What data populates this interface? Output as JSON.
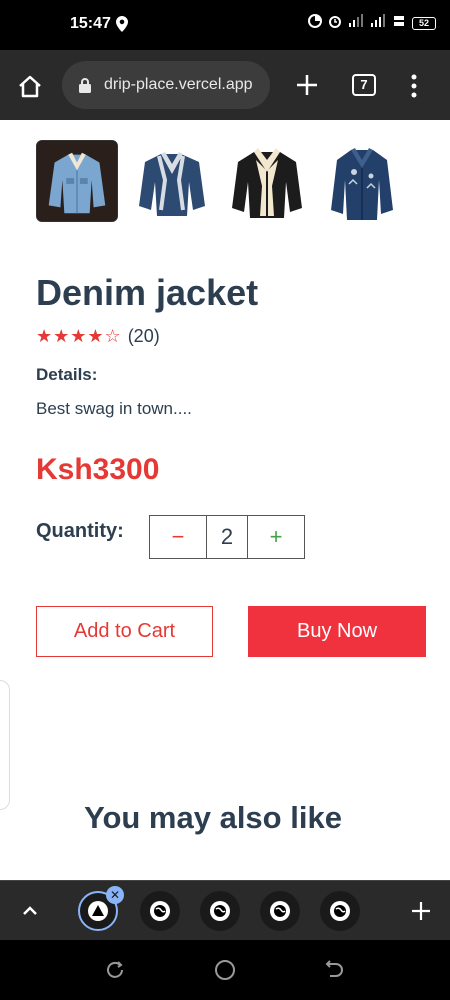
{
  "status_bar": {
    "time": "15:47",
    "battery": "52"
  },
  "browser": {
    "url": "drip-place.vercel.app",
    "tab_count": "7"
  },
  "product": {
    "thumbnails": [
      {
        "name": "light-denim-jacket",
        "colors": {
          "body": "#7aa6cf",
          "collar": "#efe6d6"
        }
      },
      {
        "name": "dark-denim-jacket",
        "colors": {
          "body": "#2d4a72",
          "collar": "#d8dde4"
        }
      },
      {
        "name": "black-sherpa-jacket",
        "colors": {
          "body": "#1c1c1c",
          "collar": "#f3e8cf"
        }
      },
      {
        "name": "embroidered-denim-jacket",
        "colors": {
          "body": "#23406a",
          "collar": "#23406a"
        }
      }
    ],
    "title": "Denim jacket",
    "rating": 4,
    "rating_max": 5,
    "stars_text": "★★★★☆",
    "reviews": "(20)",
    "details_label": "Details:",
    "details_text": "Best swag in town....",
    "price": "Ksh3300",
    "quantity_label": "Quantity:",
    "quantity": "2",
    "minus_symbol": "−",
    "plus_symbol": "+",
    "add_to_cart": "Add to Cart",
    "buy_now": "Buy Now"
  },
  "recommendations": {
    "heading": "You may also like"
  },
  "colors": {
    "accent_red": "#e53935",
    "heading_navy": "#2c3e50",
    "plus_green": "#43a047"
  },
  "tab_strip": {
    "tabs": [
      "active-tab",
      "tab-2",
      "tab-3",
      "tab-4",
      "tab-5"
    ]
  }
}
